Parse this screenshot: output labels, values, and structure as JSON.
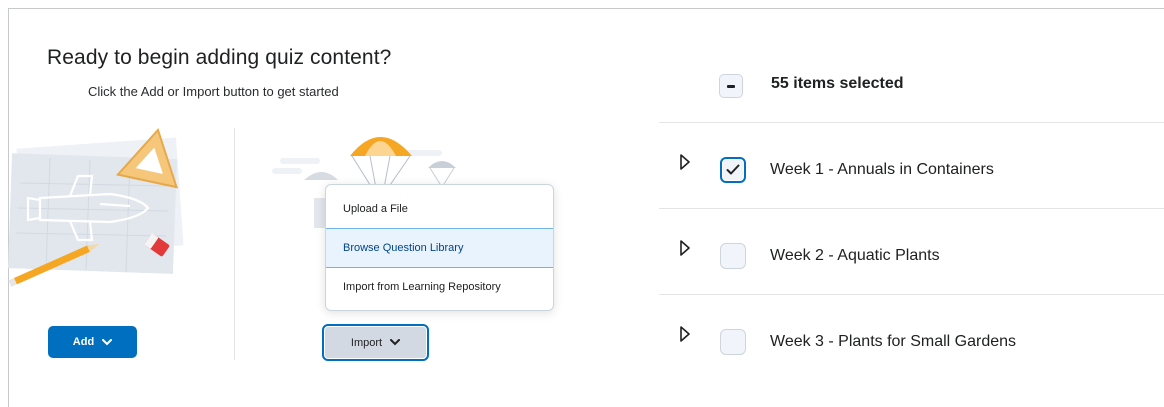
{
  "left_panel": {
    "title": "Ready to begin adding quiz content?",
    "subtitle": "Click the Add or Import button to get started",
    "add_button_label": "Add",
    "import_button_label": "Import"
  },
  "import_menu": {
    "items": [
      {
        "label": "Upload a File"
      },
      {
        "label": "Browse Question Library",
        "highlighted": true
      },
      {
        "label": "Import from Learning Repository"
      }
    ]
  },
  "right_panel": {
    "selection_text": "55 items selected",
    "rows": [
      {
        "label": "Week 1 - Annuals in Containers",
        "checked": true
      },
      {
        "label": "Week 2 - Aquatic Plants",
        "checked": false
      },
      {
        "label": "Week 3 - Plants for Small Gardens",
        "checked": false
      }
    ]
  },
  "colors": {
    "primary": "#006fbf",
    "import_bg": "#d3d9e3",
    "highlight_bg": "#e8f3fd",
    "checkbox_bg": "#f1f5fb",
    "illustration_orange": "#f5a623",
    "illustration_red": "#e23a3a"
  },
  "icons": {
    "chevron": "chevron-down-icon",
    "expand": "triangle-right-icon",
    "check": "checkmark-icon",
    "indeterminate": "minus-icon"
  }
}
